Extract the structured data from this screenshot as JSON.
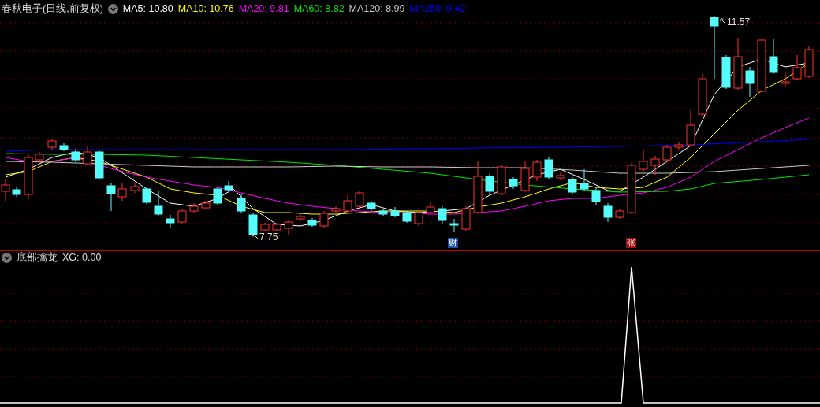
{
  "main_chart": {
    "title": "春秋电子(日线,前复权)",
    "moving_averages": [
      {
        "label": "MA5:",
        "value": "10.80",
        "color": "#ffffff"
      },
      {
        "label": "MA10:",
        "value": "10.76",
        "color": "#ffff00"
      },
      {
        "label": "MA20:",
        "value": "9.81",
        "color": "#ff00ff"
      },
      {
        "label": "MA60:",
        "value": "8.82",
        "color": "#00e600"
      },
      {
        "label": "MA120:",
        "value": "8.99",
        "color": "#c8c8c8"
      },
      {
        "label": "MA250:",
        "value": "9.42",
        "color": "#0000ff"
      }
    ],
    "high_label": "11.57",
    "low_label": "7.75",
    "event_markers": [
      {
        "text": "财",
        "kind": "finance"
      },
      {
        "text": "张",
        "kind": "rise"
      }
    ]
  },
  "indicator": {
    "name": "底部擒龙",
    "reading": "XG: 0.00"
  }
}
